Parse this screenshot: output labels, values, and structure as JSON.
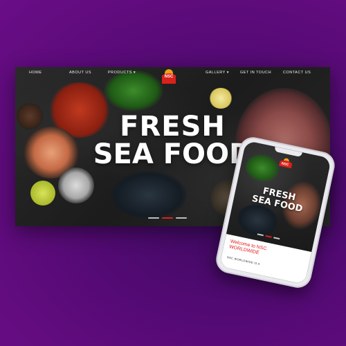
{
  "desktop": {
    "nav": {
      "home": "HOME",
      "about": "ABOUT US",
      "products": "PRODUCTS ▾",
      "gallery": "GALLERY ▾",
      "get_in_touch": "GET IN TOUCH",
      "contact": "CONTACT US"
    },
    "logo": {
      "name": "NSC",
      "icon": "sun-wave-logo"
    },
    "hero": {
      "line1": "FRESH",
      "line2": "SEA FOOD"
    },
    "slider": {
      "count": 3,
      "active_index": 1
    }
  },
  "phone": {
    "logo": "NSC",
    "hero_line1": "FRESH",
    "hero_line2": "SEA FOOD",
    "welcome_line1": "Welcome to NSC",
    "welcome_line2": "WORLDWIDE",
    "subtitle": "NSC WORLDWIDE IS A"
  },
  "colors": {
    "background": "#5e0b7c",
    "accent_red": "#e02020",
    "hero_text": "#ffffff"
  }
}
